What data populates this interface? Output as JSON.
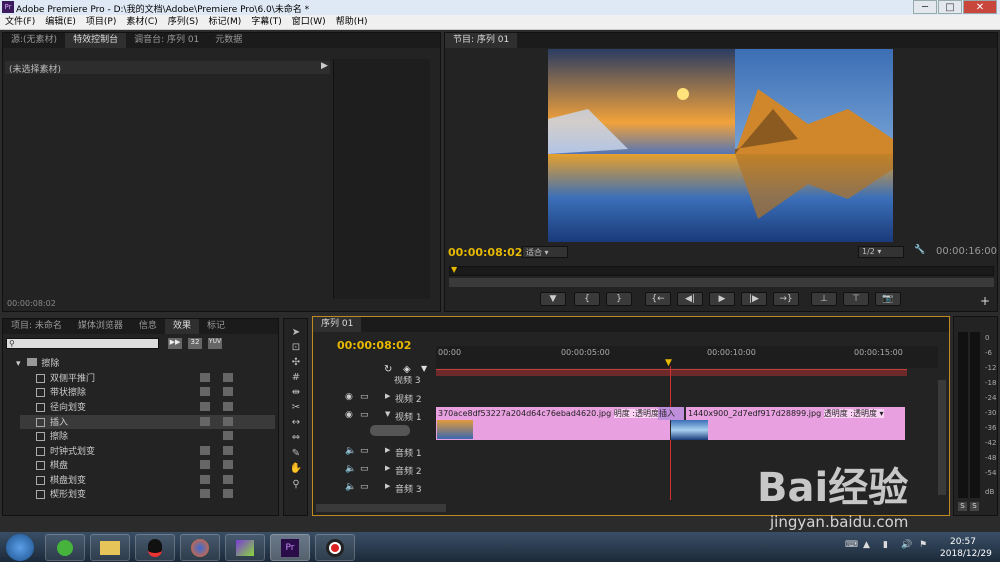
{
  "window": {
    "title": "Adobe Premiere Pro - D:\\我的文档\\Adobe\\Premiere Pro\\6.0\\未命名 *",
    "min": "─",
    "max": "□",
    "close": "✕"
  },
  "menu": [
    "文件(F)",
    "编辑(E)",
    "项目(P)",
    "素材(C)",
    "序列(S)",
    "标记(M)",
    "字幕(T)",
    "窗口(W)",
    "帮助(H)"
  ],
  "source_panel": {
    "tabs": [
      "源:(无素材)",
      "特效控制台",
      "调音台: 序列 01",
      "元数据"
    ],
    "no_clip": "(未选择素材)",
    "timecode": "00:00:08:02"
  },
  "program": {
    "tab": "节目: 序列 01",
    "timecode": "00:00:08:02",
    "fit": "适合",
    "resolution": "1/2",
    "duration": "00:00:16:00"
  },
  "project_panel": {
    "tabs": [
      "项目: 未命名",
      "媒体浏览器",
      "信息",
      "效果",
      "标记"
    ],
    "folder": "擦除",
    "items": [
      "双侧平推门",
      "带状擦除",
      "径向划变",
      "插入",
      "擦除",
      "时钟式划变",
      "棋盘",
      "棋盘划变",
      "楔形划变"
    ]
  },
  "timeline": {
    "tab": "序列 01",
    "timecode": "00:00:08:02",
    "ruler": [
      "00:00",
      "00:00:05:00",
      "00:00:10:00",
      "00:00:15:00"
    ],
    "tracks": {
      "v3": "视频 3",
      "v2": "视频 2",
      "v1": "视频 1",
      "a1": "音频 1",
      "a2": "音频 2",
      "a3": "音频 3"
    },
    "clip1": "370ace8df53227a204d64c76ebad4620.jpg",
    "clip1_fx": "明度 :透明度 ▾",
    "transition": "插入",
    "clip2": "1440x900_2d7edf917d28899.jpg",
    "clip2_fx": "透明度 :透明度 ▾"
  },
  "meter": {
    "labels": [
      "0",
      "-6",
      "-12",
      "-18",
      "-24",
      "-30",
      "-36",
      "-42",
      "-48",
      "-54",
      "dB"
    ],
    "solo": "S"
  },
  "taskbar": {
    "time": "20:57",
    "date": "2018/12/29"
  },
  "watermark": {
    "brand": "Bai经验",
    "url": "jingyan.baidu.com"
  }
}
